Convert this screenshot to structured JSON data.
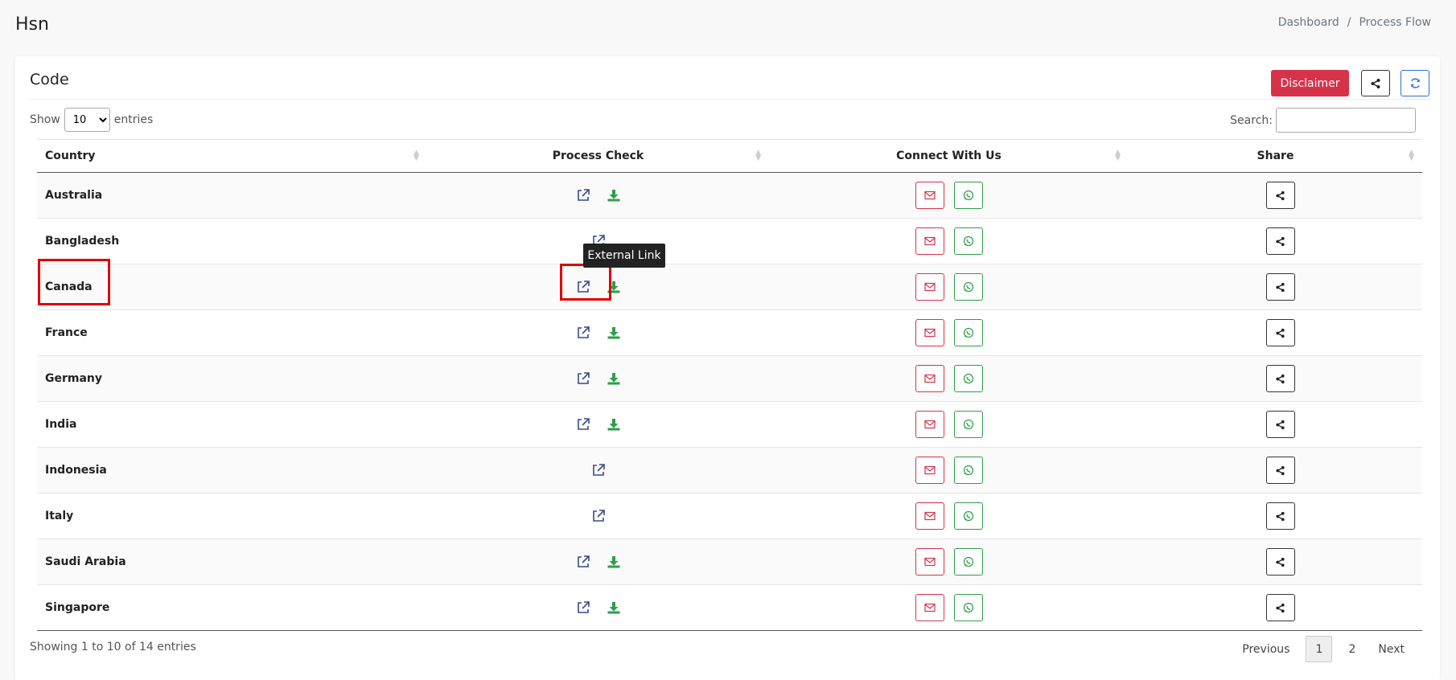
{
  "header": {
    "title": "Hsn",
    "breadcrumb": [
      "Dashboard",
      "Process Flow"
    ],
    "breadcrumb_sep": "/"
  },
  "card": {
    "title": "Code",
    "disclaimer_label": "Disclaimer",
    "share_icon": "share-icon",
    "refresh_icon": "refresh-icon"
  },
  "controls": {
    "show_label": "Show",
    "entries_label": "entries",
    "length_value": "10",
    "search_label": "Search:",
    "search_value": ""
  },
  "table": {
    "columns": [
      "Country",
      "Process Check",
      "Connect With Us",
      "Share"
    ],
    "rows": [
      {
        "country": "Australia",
        "download": true
      },
      {
        "country": "Bangladesh",
        "download": false
      },
      {
        "country": "Canada",
        "download": true
      },
      {
        "country": "France",
        "download": true
      },
      {
        "country": "Germany",
        "download": true
      },
      {
        "country": "India",
        "download": true
      },
      {
        "country": "Indonesia",
        "download": false
      },
      {
        "country": "Italy",
        "download": false
      },
      {
        "country": "Saudi Arabia",
        "download": true
      },
      {
        "country": "Singapore",
        "download": true
      }
    ]
  },
  "tooltip": "External Link",
  "footer": {
    "info": "Showing 1 to 10 of 14 entries",
    "previous": "Previous",
    "pages": [
      "1",
      "2"
    ],
    "next": "Next"
  },
  "colors": {
    "danger": "#d6334b",
    "success": "#2e9e4a",
    "primary": "#2a6fdb",
    "link_icon": "#3a4a8a",
    "highlight": "#e00000"
  }
}
